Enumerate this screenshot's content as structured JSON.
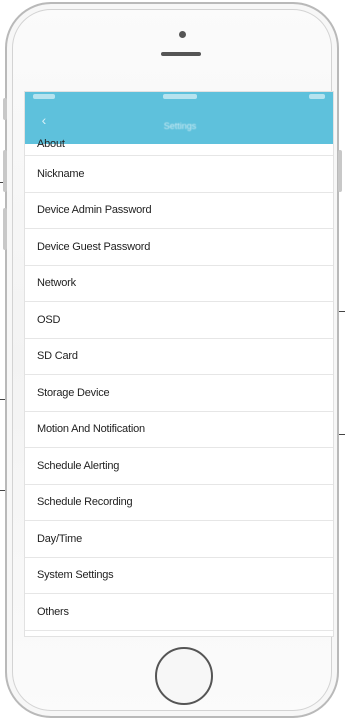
{
  "app": {
    "header_title": "Settings",
    "back_icon": "chevron-left-icon"
  },
  "settings_menu": [
    "About",
    "Nickname",
    "Device Admin Password",
    "Device Guest Password",
    "Network",
    "OSD",
    "SD Card",
    "Storage Device",
    "Motion And Notification",
    "Schedule Alerting",
    "Schedule Recording",
    "Day/Time",
    "System Settings",
    "Others"
  ],
  "colors": {
    "header": "#5ec1dc",
    "phone_frame": "#b9b9b9",
    "text": "#222222"
  }
}
